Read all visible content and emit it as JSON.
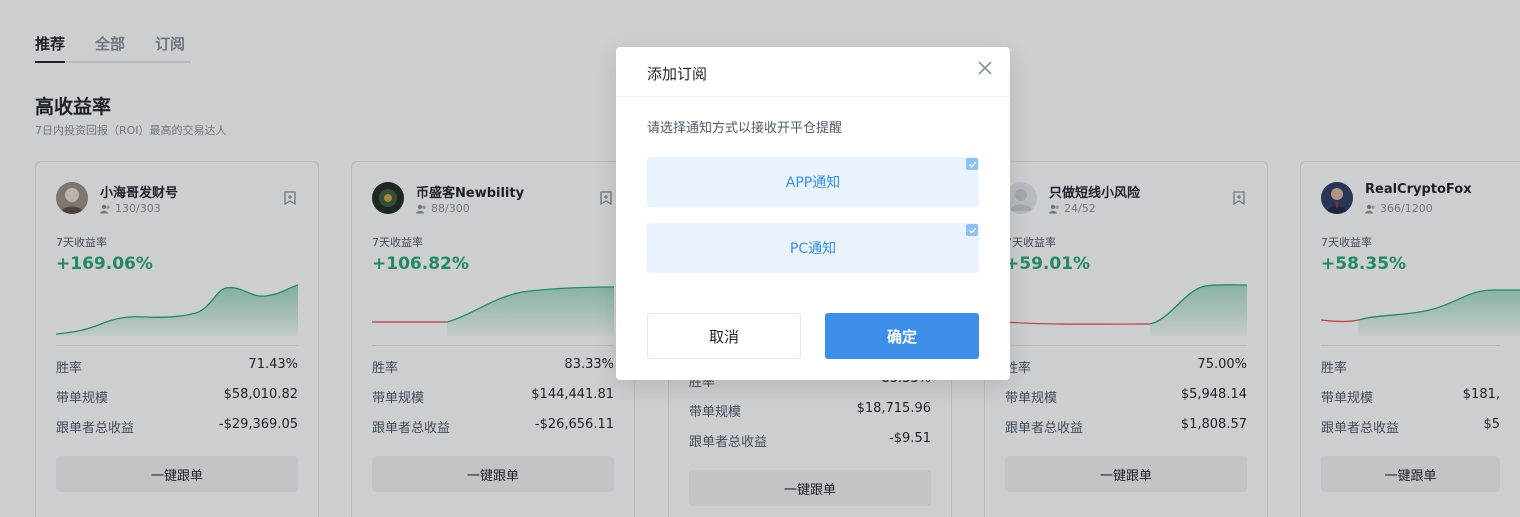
{
  "tabs": [
    {
      "label": "推荐",
      "active": true
    },
    {
      "label": "全部",
      "active": false
    },
    {
      "label": "订阅",
      "active": false
    }
  ],
  "section": {
    "title": "高收益率",
    "subtitle": "7日内投资回报（ROI）最高的交易达人"
  },
  "card_labels": {
    "roi_label": "7天收益率",
    "win_rate": "胜率",
    "scale": "带单规模",
    "follower_pnl": "跟单者总收益",
    "follow_button": "一键跟单"
  },
  "cards": [
    {
      "name": "小海哥发财号",
      "followers": "130/303",
      "roi": "+169.06%",
      "win_rate": "71.43%",
      "scale": "$58,010.82",
      "follower_pnl": "-$29,369.05",
      "avatar": "avatar-icon"
    },
    {
      "name": "币盛客Newbility",
      "followers": "88/300",
      "roi": "+106.82%",
      "win_rate": "83.33%",
      "scale": "$144,441.81",
      "follower_pnl": "-$26,656.11",
      "avatar": "avatar-icon"
    },
    {
      "name": "",
      "followers": "",
      "roi": "",
      "win_rate": "83.33%",
      "scale": "$18,715.96",
      "follower_pnl": "-$9.51",
      "avatar": "avatar-icon"
    },
    {
      "name": "只做短线小风险",
      "followers": "24/52",
      "roi": "+59.01%",
      "win_rate": "75.00%",
      "scale": "$5,948.14",
      "follower_pnl": "$1,808.57",
      "avatar": "default-avatar-icon"
    },
    {
      "name": "RealCryptoFox",
      "followers": "366/1200",
      "roi": "+58.35%",
      "win_rate": "",
      "scale": "$181,",
      "follower_pnl": "$5",
      "avatar": "avatar-icon"
    }
  ],
  "modal": {
    "title": "添加订阅",
    "hint": "请选择通知方式以接收开平仓提醒",
    "options": [
      {
        "label": "APP通知",
        "checked": true
      },
      {
        "label": "PC通知",
        "checked": true
      }
    ],
    "cancel_label": "取消",
    "confirm_label": "确定"
  },
  "colors": {
    "accent": "#3c8ee8",
    "positive": "#27a67a",
    "negative": "#e5484d"
  }
}
